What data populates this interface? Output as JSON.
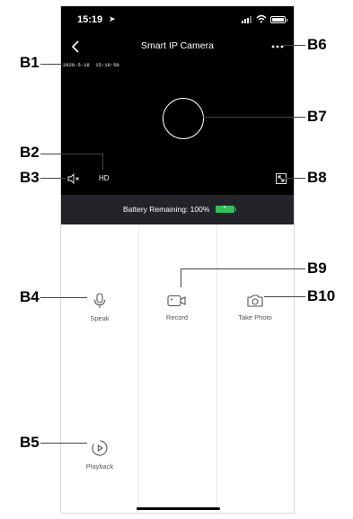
{
  "status_bar": {
    "time": "15:19",
    "location_arrow": "➤"
  },
  "nav": {
    "back_icon": "chevron-left-icon",
    "title": "Smart IP Camera",
    "more_icon": "more-horizontal-icon"
  },
  "video": {
    "timestamp": "2020-5-18  15:19:50",
    "quality_label": "HD"
  },
  "battery_banner": {
    "text": "Battery Remaining: 100%",
    "level_percent": 100,
    "color": "#31c15a"
  },
  "controls": {
    "speak_label": "Speak",
    "record_label": "Record",
    "photo_label": "Take Photo",
    "playback_label": "Playback"
  },
  "callouts": {
    "b1": "B1",
    "b2": "B2",
    "b3": "B3",
    "b4": "B4",
    "b5": "B5",
    "b6": "B6",
    "b7": "B7",
    "b8": "B8",
    "b9": "B9",
    "b10": "B10"
  }
}
